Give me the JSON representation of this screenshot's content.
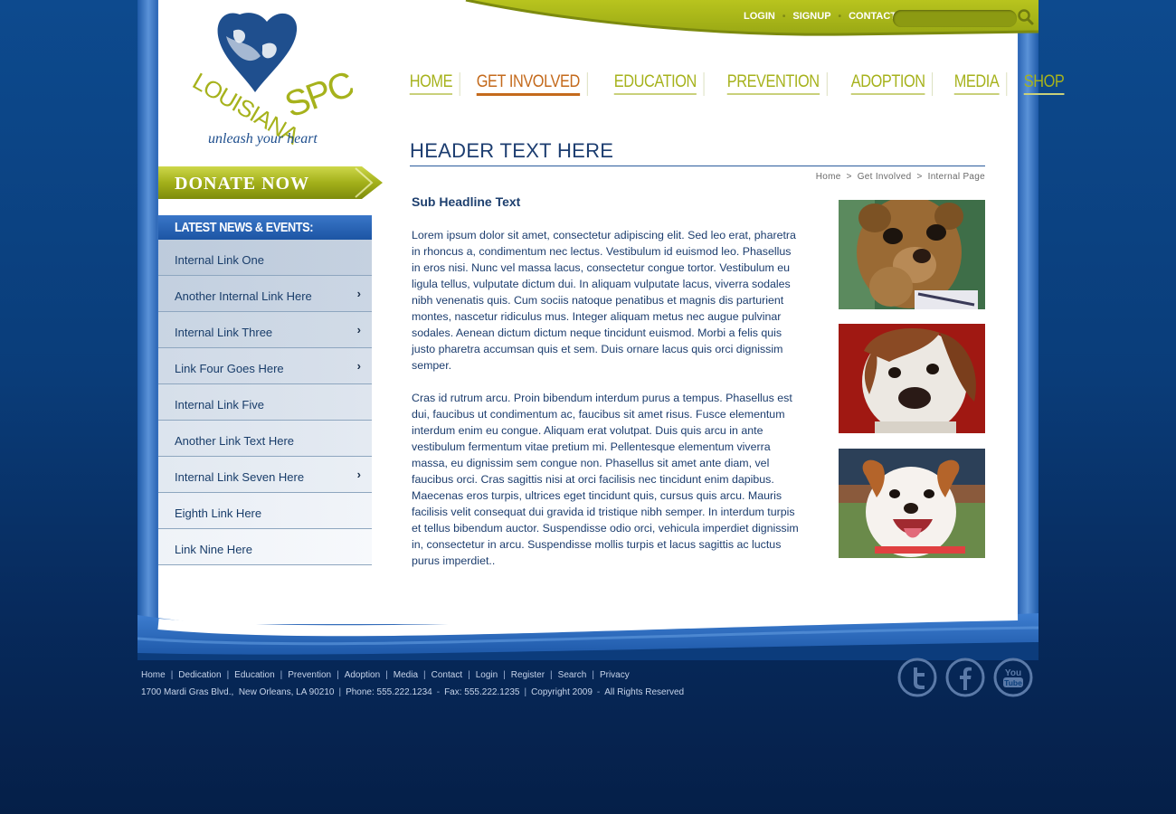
{
  "top_links": [
    "LOGIN",
    "SIGNUP",
    "CONTACT"
  ],
  "search": {
    "placeholder": ""
  },
  "logo": {
    "name": "LOUISIANA SPCA",
    "tagline": "unleash your heart"
  },
  "main_nav": [
    {
      "label": "HOME",
      "active": false
    },
    {
      "label": "GET INVOLVED",
      "active": true
    },
    {
      "label": "EDUCATION",
      "active": false
    },
    {
      "label": "PREVENTION",
      "active": false
    },
    {
      "label": "ADOPTION",
      "active": false
    },
    {
      "label": "MEDIA",
      "active": false
    },
    {
      "label": "SHOP",
      "active": false
    }
  ],
  "donate": {
    "label": "DONATE NOW"
  },
  "sidebar": {
    "title": "LATEST NEWS & EVENTS:",
    "items": [
      {
        "label": "Internal Link One",
        "chevron": ""
      },
      {
        "label": "Another Internal Link Here",
        "chevron": "›"
      },
      {
        "label": "Internal Link Three",
        "chevron": "›"
      },
      {
        "label": "Link Four Goes Here",
        "chevron": "›"
      },
      {
        "label": "Internal Link Five",
        "chevron": ""
      },
      {
        "label": "Another Link Text Here",
        "chevron": ""
      },
      {
        "label": "Internal Link Seven Here",
        "chevron": "›"
      },
      {
        "label": "Eighth Link Here",
        "chevron": ""
      },
      {
        "label": "Link Nine Here",
        "chevron": ""
      }
    ]
  },
  "content": {
    "header": "HEADER TEXT HERE",
    "breadcrumb": [
      "Home",
      "Get Involved",
      "Internal Page"
    ],
    "breadcrumb_sep": ">",
    "subheadline": "Sub Headline Text",
    "paragraph1": "Lorem ipsum dolor sit amet, consectetur adipiscing elit. Sed leo erat, pharetra in rhoncus a, condimentum nec lectus. Vestibulum id euismod leo. Phasellus in eros nisi. Nunc vel massa lacus, consectetur congue tortor. Vestibulum eu ligula tellus, vulputate dictum dui. In aliquam vulputate lacus, viverra sodales nibh venenatis quis. Cum sociis natoque penatibus et magnis dis parturient montes, nascetur ridiculus mus. Integer aliquam metus nec augue pulvinar sodales. Aenean dictum dictum neque tincidunt euismod. Morbi a felis quis justo pharetra accumsan quis et sem. Duis ornare lacus quis orci dignissim semper.",
    "paragraph2": "Cras id rutrum arcu. Proin bibendum interdum purus a tempus. Phasellus est dui, faucibus ut condimentum ac, faucibus sit amet risus. Fusce elementum interdum enim eu congue. Aliquam erat volutpat. Duis quis arcu in ante vestibulum fermentum vitae pretium mi. Pellentesque elementum viverra massa, eu dignissim sem congue non. Phasellus sit amet ante diam, vel faucibus orci. Cras sagittis nisi at orci facilisis nec tincidunt enim dapibus. Maecenas eros turpis, ultrices eget tincidunt quis, cursus quis arcu. Mauris facilisis velit consequat dui gravida id tristique nibh semper. In interdum turpis et tellus bibendum auctor. Suspendisse odio orci, vehicula imperdiet dignissim in, consectetur in arcu. Suspendisse mollis turpis et lacus sagittis ac luctus purus imperdiet..",
    "photos": [
      "mascot-photo",
      "boxer-puppy-photo",
      "smiling-dog-photo"
    ]
  },
  "footer": {
    "links": [
      "Home",
      "Dedication",
      "Education",
      "Prevention",
      "Adoption",
      "Media",
      "Contact",
      "Login",
      "Register",
      "Search",
      "Privacy"
    ],
    "address": [
      "1700 Mardi Gras Blvd.,  New Orleans, LA 90210",
      "Phone: 555.222.1234",
      "Fax: 555.222.1235",
      "Copyright 2009",
      "All Rights Reserved"
    ],
    "social": [
      "twitter-icon",
      "facebook-icon",
      "youtube-icon"
    ]
  },
  "colors": {
    "brand_green": "#a6b21c",
    "active_orange": "#c46a1c",
    "brand_blue": "#1c3d70",
    "background": "#0a3d7a"
  }
}
